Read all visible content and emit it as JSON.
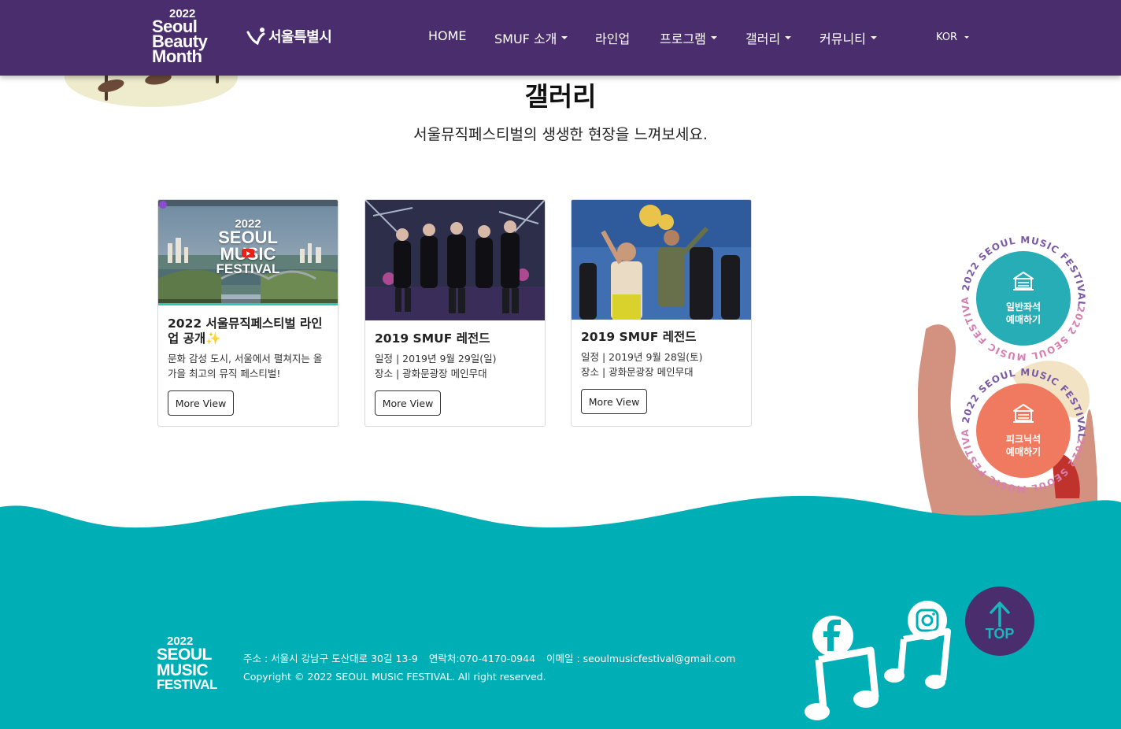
{
  "brand": {
    "logo_year": "2022",
    "logo_words": [
      "Seoul",
      "Beauty",
      "Month"
    ],
    "partner_logo_text": "서울특별시"
  },
  "nav": {
    "items": [
      {
        "label": "HOME",
        "dropdown": false
      },
      {
        "label": "SMUF 소개",
        "dropdown": true
      },
      {
        "label": "라인업",
        "dropdown": false
      },
      {
        "label": "프로그램",
        "dropdown": true
      },
      {
        "label": "갤러리",
        "dropdown": true
      },
      {
        "label": "커뮤니티",
        "dropdown": true
      }
    ],
    "language": "KOR"
  },
  "page": {
    "title": "갤러리",
    "subtitle": "서울뮤직페스티벌의 생생한 현장을 느껴보세요."
  },
  "cards": [
    {
      "title": "2022 서울뮤직페스티벌 라인업 공개",
      "title_emoji": "✨",
      "lines": [
        "문화 감성 도시, 서울에서 펼쳐지는 올가을 최고의 뮤직 페스티벌!"
      ],
      "button": "More View",
      "thumb_text": [
        "2022",
        "SEOUL",
        "MUSIC",
        "FESTIVAL"
      ]
    },
    {
      "title": "2019 SMUF 레전드",
      "lines": [
        "일정 | 2019년 9월 29일(일)",
        "장소 | 광화문광장 메인무대"
      ],
      "button": "More View"
    },
    {
      "title": "2019 SMUF 레전드",
      "lines": [
        "일정 | 2019년 9월 28일(토)",
        "장소 | 광화문광장 메인무대"
      ],
      "button": "More View"
    }
  ],
  "reserve": [
    {
      "line1": "일반좌석",
      "line2": "예매하기",
      "ring_text": "2022 SEOUL MUSIC FESTIVAL",
      "color": "#27adb5"
    },
    {
      "line1": "피크닉석",
      "line2": "예매하기",
      "ring_text": "2022 SEOUL MUSIC FESTIVAL",
      "color": "#ef7a5f"
    }
  ],
  "footer": {
    "logo_year": "2022",
    "logo_words": [
      "SEOUL",
      "MUSIC",
      "FESTIVAL"
    ],
    "address": "주소 : 서울시 강남구 도산대로 30길 13-9",
    "phone": "연락처:070-4170-0944",
    "email": "이메일 : seoulmusicfestival@gmail.com",
    "copyright": "Copyright © 2022 SEOUL MUSIC FESTIVAL. All right reserved.",
    "top_label": "TOP"
  },
  "colors": {
    "header_bg": "#4a2d6d",
    "footer_teal": "#00aeb6",
    "reserve_teal": "#27adb5",
    "reserve_coral": "#ef7a5f"
  }
}
